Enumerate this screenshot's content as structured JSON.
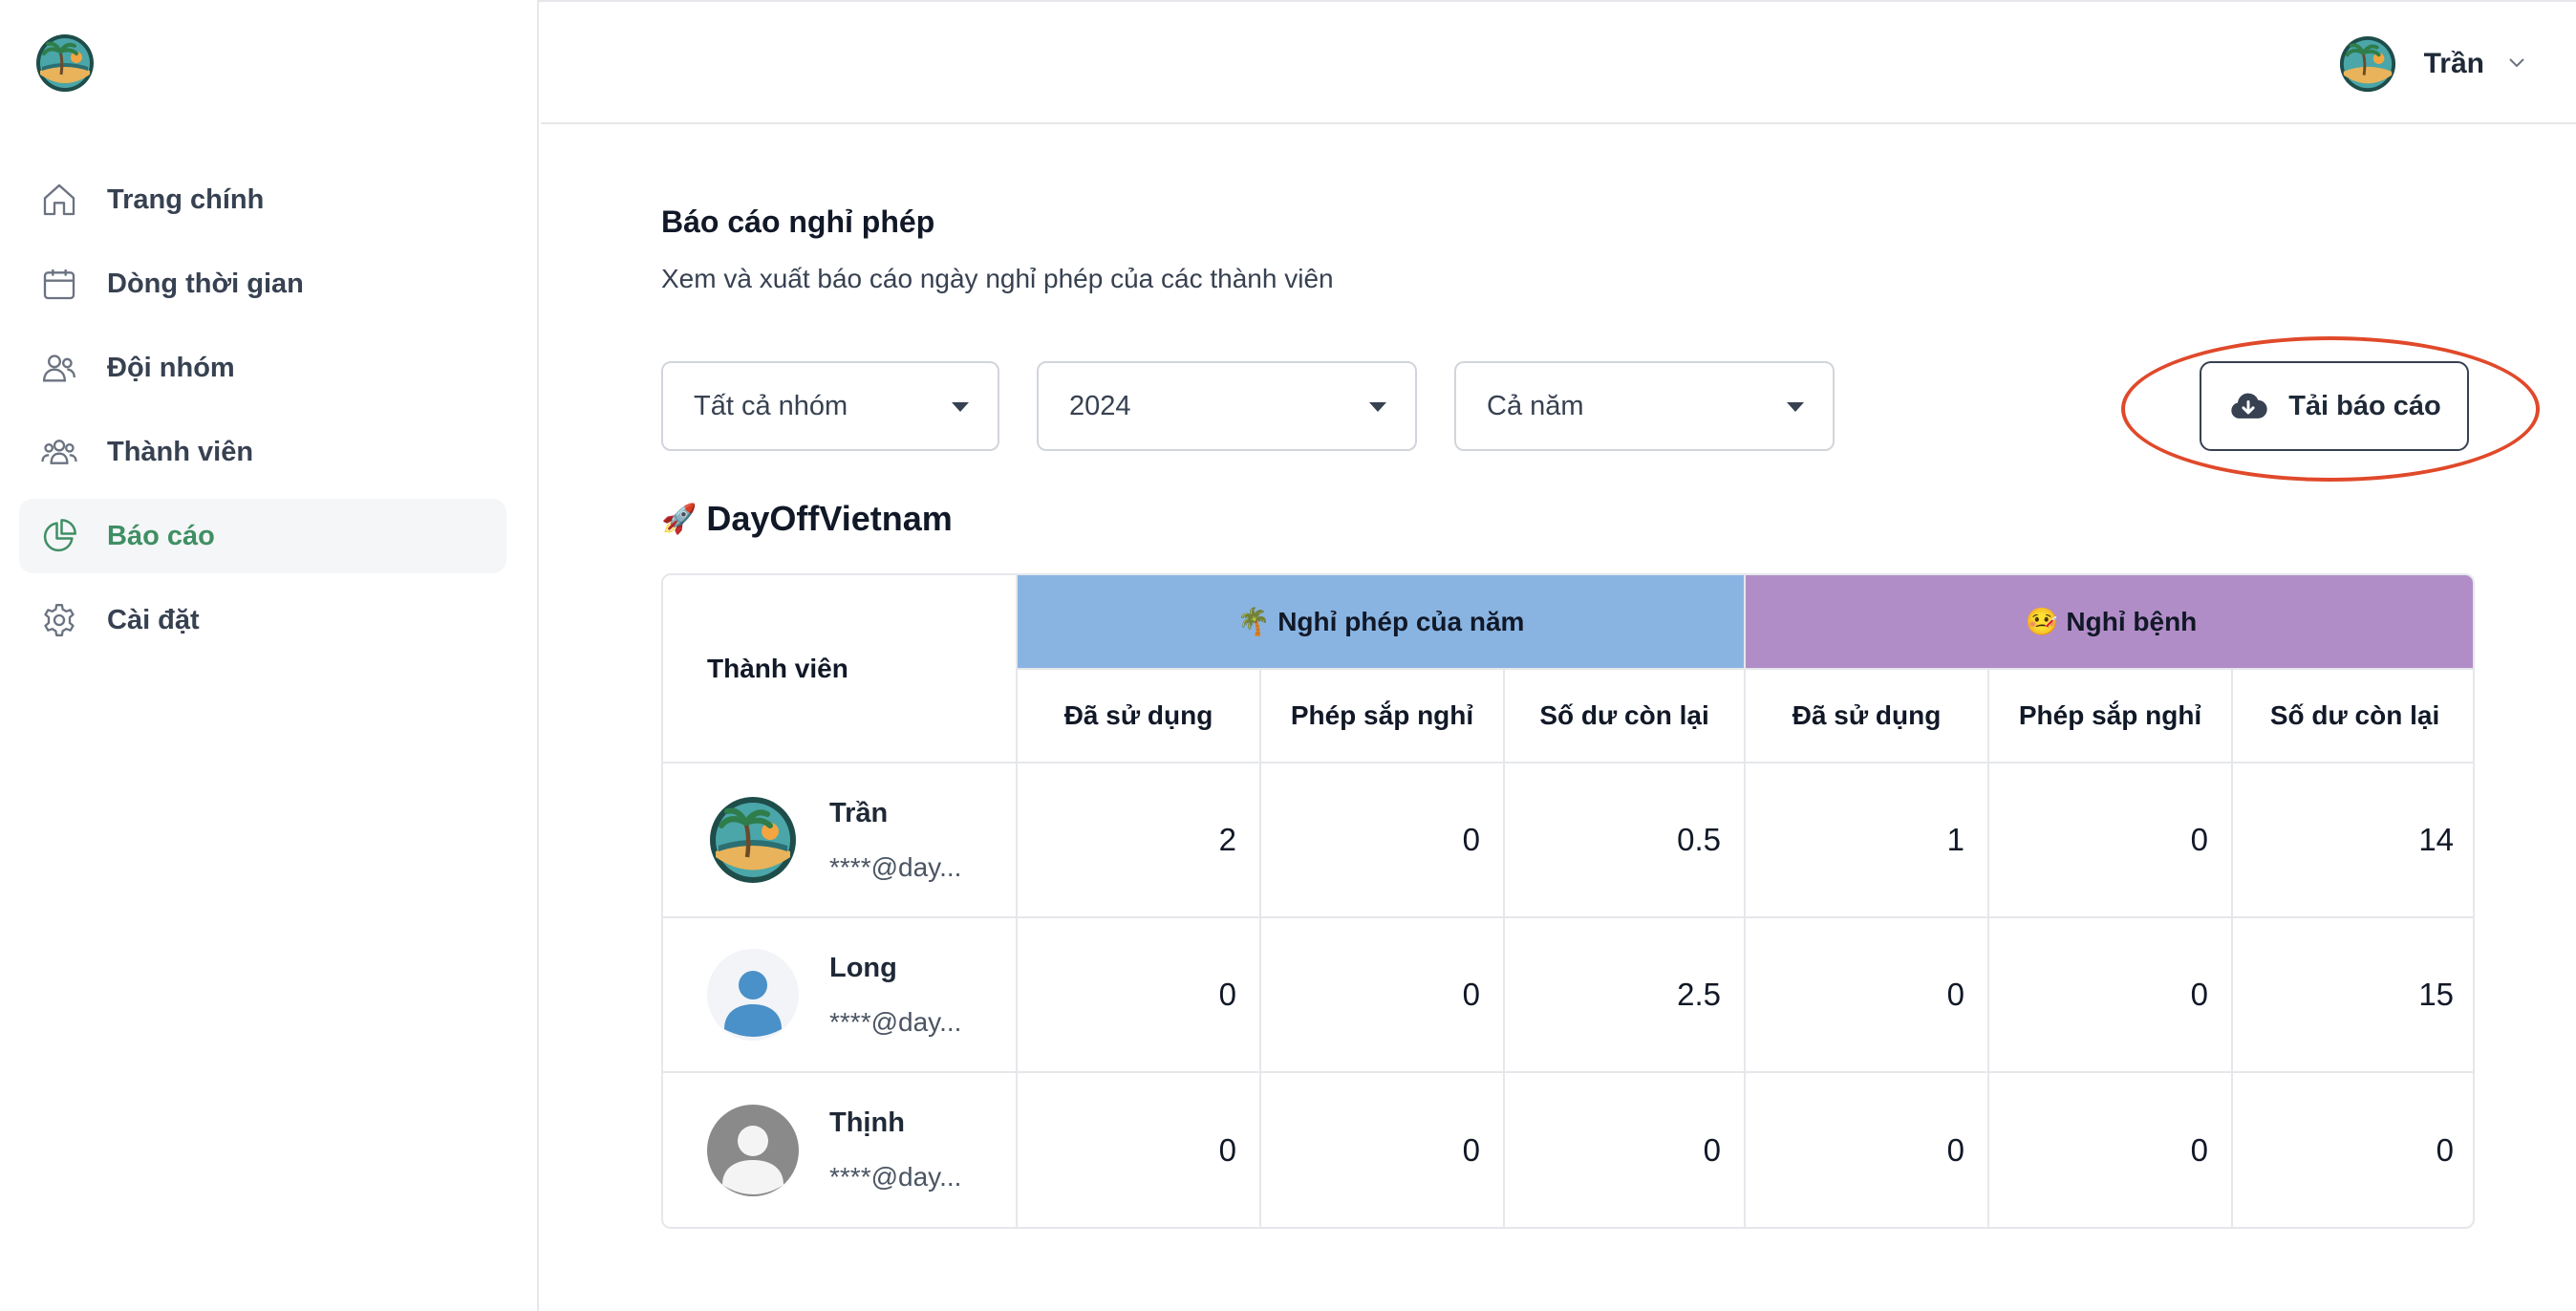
{
  "app": {
    "brand_colors": {
      "accent": "#3f8f64",
      "annual_header": "#89b4e2",
      "sick_header": "#b18dc7",
      "highlight": "#e0492a"
    }
  },
  "sidebar": {
    "logo_icon": "palm-beach-logo-icon",
    "items": [
      {
        "label": "Trang chính",
        "icon": "home-icon",
        "active": false
      },
      {
        "label": "Dòng thời gian",
        "icon": "calendar-icon",
        "active": false
      },
      {
        "label": "Đội nhóm",
        "icon": "team-icon",
        "active": false
      },
      {
        "label": "Thành viên",
        "icon": "members-icon",
        "active": false
      },
      {
        "label": "Báo cáo",
        "icon": "pie-chart-icon",
        "active": true
      },
      {
        "label": "Cài đặt",
        "icon": "gear-icon",
        "active": false
      }
    ]
  },
  "header": {
    "user_name": "Trần",
    "user_avatar": "palm-beach-avatar"
  },
  "main": {
    "title": "Báo cáo nghỉ phép",
    "subtitle": "Xem và xuất báo cáo ngày nghỉ phép của các thành viên",
    "filters": {
      "group": "Tất cả nhóm",
      "year": "2024",
      "period": "Cả năm"
    },
    "download_label": "Tải báo cáo",
    "group_emoji": "🚀",
    "group_name": "DayOffVietnam",
    "table": {
      "member_header": "Thành viên",
      "annual_header": "🌴 Nghỉ phép của năm",
      "sick_header": "🤒 Nghỉ bệnh",
      "sub_headers": [
        "Đã sử dụng",
        "Phép sắp nghỉ",
        "Số dư còn lại",
        "Đã sử dụng",
        "Phép sắp nghỉ",
        "Số dư còn lại"
      ],
      "rows": [
        {
          "name": "Trần",
          "email": "****@day...",
          "avatar": "palm-beach-avatar",
          "values": [
            "2",
            "0",
            "0.5",
            "1",
            "0",
            "14"
          ]
        },
        {
          "name": "Long",
          "email": "****@day...",
          "avatar": "blue-person-avatar",
          "values": [
            "0",
            "0",
            "2.5",
            "0",
            "0",
            "15"
          ]
        },
        {
          "name": "Thịnh",
          "email": "****@day...",
          "avatar": "gray-person-avatar",
          "values": [
            "0",
            "0",
            "0",
            "0",
            "0",
            "0"
          ]
        }
      ]
    }
  }
}
